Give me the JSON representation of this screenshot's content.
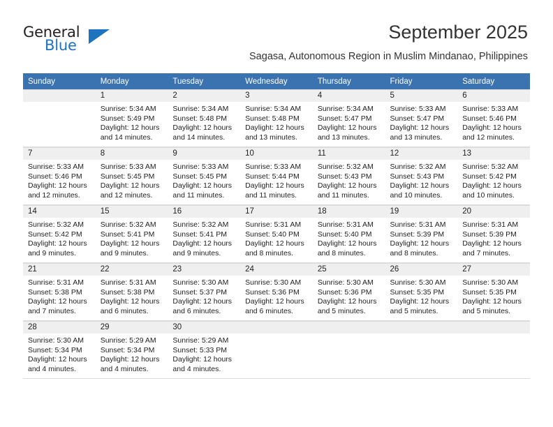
{
  "brand": {
    "name_part1": "General",
    "name_part2": "Blue",
    "triangle_color": "#1e73be"
  },
  "header": {
    "month_title": "September 2025",
    "location": "Sagasa, Autonomous Region in Muslim Mindanao, Philippines"
  },
  "colors": {
    "header_row_bg": "#3b72b0",
    "header_row_text": "#ffffff",
    "daynum_bg": "#efefef",
    "grid_line": "#dcdcdc",
    "brand_blue": "#1e73be"
  },
  "weekday_headers": [
    "Sunday",
    "Monday",
    "Tuesday",
    "Wednesday",
    "Thursday",
    "Friday",
    "Saturday"
  ],
  "labels": {
    "sunrise_prefix": "Sunrise:",
    "sunset_prefix": "Sunset:",
    "daylight_prefix": "Daylight:"
  },
  "weeks": [
    [
      {
        "day": "",
        "lines": []
      },
      {
        "day": "1",
        "lines": [
          "Sunrise: 5:34 AM",
          "Sunset: 5:49 PM",
          "Daylight: 12 hours",
          "and 14 minutes."
        ]
      },
      {
        "day": "2",
        "lines": [
          "Sunrise: 5:34 AM",
          "Sunset: 5:48 PM",
          "Daylight: 12 hours",
          "and 14 minutes."
        ]
      },
      {
        "day": "3",
        "lines": [
          "Sunrise: 5:34 AM",
          "Sunset: 5:48 PM",
          "Daylight: 12 hours",
          "and 13 minutes."
        ]
      },
      {
        "day": "4",
        "lines": [
          "Sunrise: 5:34 AM",
          "Sunset: 5:47 PM",
          "Daylight: 12 hours",
          "and 13 minutes."
        ]
      },
      {
        "day": "5",
        "lines": [
          "Sunrise: 5:33 AM",
          "Sunset: 5:47 PM",
          "Daylight: 12 hours",
          "and 13 minutes."
        ]
      },
      {
        "day": "6",
        "lines": [
          "Sunrise: 5:33 AM",
          "Sunset: 5:46 PM",
          "Daylight: 12 hours",
          "and 12 minutes."
        ]
      }
    ],
    [
      {
        "day": "7",
        "lines": [
          "Sunrise: 5:33 AM",
          "Sunset: 5:46 PM",
          "Daylight: 12 hours",
          "and 12 minutes."
        ]
      },
      {
        "day": "8",
        "lines": [
          "Sunrise: 5:33 AM",
          "Sunset: 5:45 PM",
          "Daylight: 12 hours",
          "and 12 minutes."
        ]
      },
      {
        "day": "9",
        "lines": [
          "Sunrise: 5:33 AM",
          "Sunset: 5:45 PM",
          "Daylight: 12 hours",
          "and 11 minutes."
        ]
      },
      {
        "day": "10",
        "lines": [
          "Sunrise: 5:33 AM",
          "Sunset: 5:44 PM",
          "Daylight: 12 hours",
          "and 11 minutes."
        ]
      },
      {
        "day": "11",
        "lines": [
          "Sunrise: 5:32 AM",
          "Sunset: 5:43 PM",
          "Daylight: 12 hours",
          "and 11 minutes."
        ]
      },
      {
        "day": "12",
        "lines": [
          "Sunrise: 5:32 AM",
          "Sunset: 5:43 PM",
          "Daylight: 12 hours",
          "and 10 minutes."
        ]
      },
      {
        "day": "13",
        "lines": [
          "Sunrise: 5:32 AM",
          "Sunset: 5:42 PM",
          "Daylight: 12 hours",
          "and 10 minutes."
        ]
      }
    ],
    [
      {
        "day": "14",
        "lines": [
          "Sunrise: 5:32 AM",
          "Sunset: 5:42 PM",
          "Daylight: 12 hours",
          "and 9 minutes."
        ]
      },
      {
        "day": "15",
        "lines": [
          "Sunrise: 5:32 AM",
          "Sunset: 5:41 PM",
          "Daylight: 12 hours",
          "and 9 minutes."
        ]
      },
      {
        "day": "16",
        "lines": [
          "Sunrise: 5:32 AM",
          "Sunset: 5:41 PM",
          "Daylight: 12 hours",
          "and 9 minutes."
        ]
      },
      {
        "day": "17",
        "lines": [
          "Sunrise: 5:31 AM",
          "Sunset: 5:40 PM",
          "Daylight: 12 hours",
          "and 8 minutes."
        ]
      },
      {
        "day": "18",
        "lines": [
          "Sunrise: 5:31 AM",
          "Sunset: 5:40 PM",
          "Daylight: 12 hours",
          "and 8 minutes."
        ]
      },
      {
        "day": "19",
        "lines": [
          "Sunrise: 5:31 AM",
          "Sunset: 5:39 PM",
          "Daylight: 12 hours",
          "and 8 minutes."
        ]
      },
      {
        "day": "20",
        "lines": [
          "Sunrise: 5:31 AM",
          "Sunset: 5:39 PM",
          "Daylight: 12 hours",
          "and 7 minutes."
        ]
      }
    ],
    [
      {
        "day": "21",
        "lines": [
          "Sunrise: 5:31 AM",
          "Sunset: 5:38 PM",
          "Daylight: 12 hours",
          "and 7 minutes."
        ]
      },
      {
        "day": "22",
        "lines": [
          "Sunrise: 5:31 AM",
          "Sunset: 5:38 PM",
          "Daylight: 12 hours",
          "and 6 minutes."
        ]
      },
      {
        "day": "23",
        "lines": [
          "Sunrise: 5:30 AM",
          "Sunset: 5:37 PM",
          "Daylight: 12 hours",
          "and 6 minutes."
        ]
      },
      {
        "day": "24",
        "lines": [
          "Sunrise: 5:30 AM",
          "Sunset: 5:36 PM",
          "Daylight: 12 hours",
          "and 6 minutes."
        ]
      },
      {
        "day": "25",
        "lines": [
          "Sunrise: 5:30 AM",
          "Sunset: 5:36 PM",
          "Daylight: 12 hours",
          "and 5 minutes."
        ]
      },
      {
        "day": "26",
        "lines": [
          "Sunrise: 5:30 AM",
          "Sunset: 5:35 PM",
          "Daylight: 12 hours",
          "and 5 minutes."
        ]
      },
      {
        "day": "27",
        "lines": [
          "Sunrise: 5:30 AM",
          "Sunset: 5:35 PM",
          "Daylight: 12 hours",
          "and 5 minutes."
        ]
      }
    ],
    [
      {
        "day": "28",
        "lines": [
          "Sunrise: 5:30 AM",
          "Sunset: 5:34 PM",
          "Daylight: 12 hours",
          "and 4 minutes."
        ]
      },
      {
        "day": "29",
        "lines": [
          "Sunrise: 5:29 AM",
          "Sunset: 5:34 PM",
          "Daylight: 12 hours",
          "and 4 minutes."
        ]
      },
      {
        "day": "30",
        "lines": [
          "Sunrise: 5:29 AM",
          "Sunset: 5:33 PM",
          "Daylight: 12 hours",
          "and 4 minutes."
        ]
      },
      {
        "day": "",
        "lines": []
      },
      {
        "day": "",
        "lines": []
      },
      {
        "day": "",
        "lines": []
      },
      {
        "day": "",
        "lines": []
      }
    ]
  ]
}
